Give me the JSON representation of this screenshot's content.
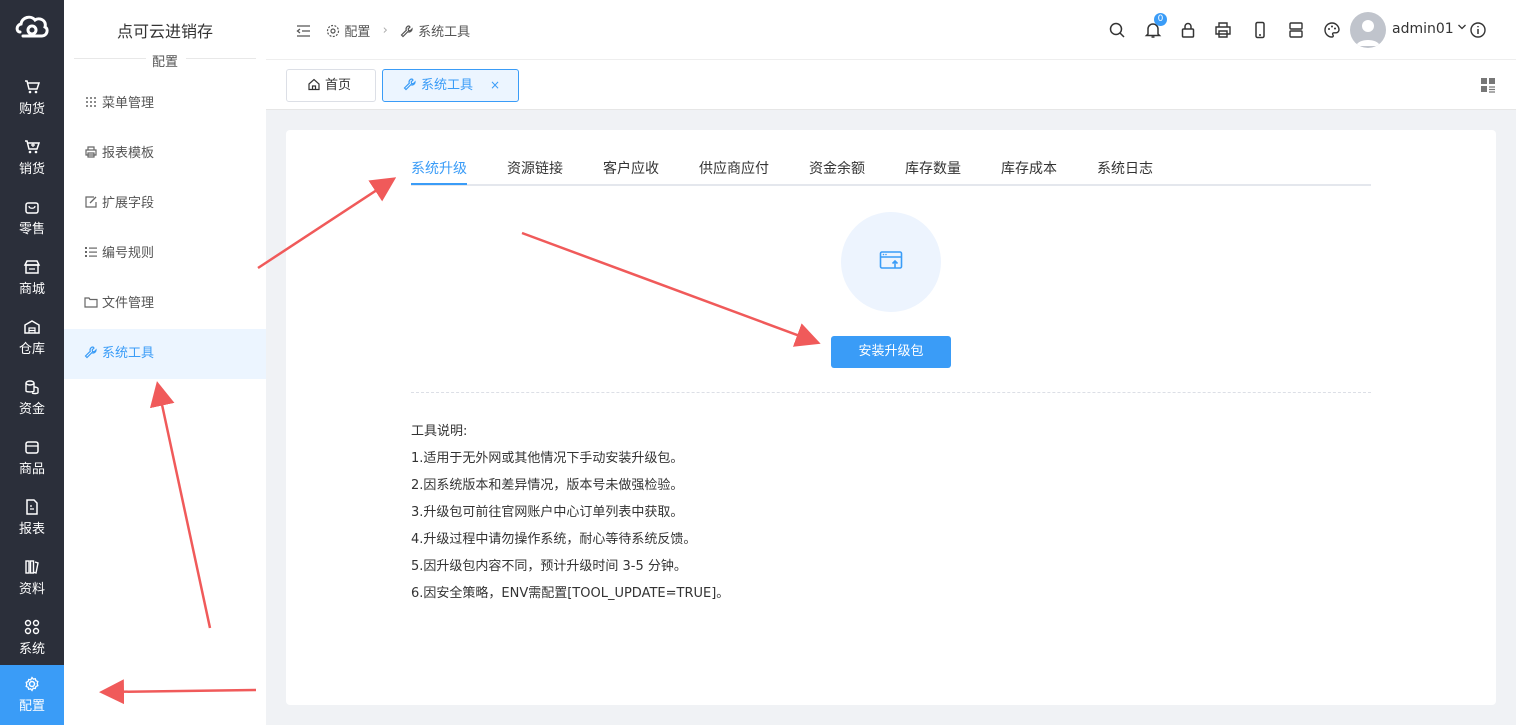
{
  "app": {
    "title": "点可云进销存"
  },
  "leftnav": {
    "items": [
      {
        "label": "购货",
        "icon": "cart-icon"
      },
      {
        "label": "销货",
        "icon": "cart-plus-icon"
      },
      {
        "label": "零售",
        "icon": "bag-icon"
      },
      {
        "label": "商城",
        "icon": "store-icon"
      },
      {
        "label": "仓库",
        "icon": "warehouse-icon"
      },
      {
        "label": "资金",
        "icon": "coins-icon"
      },
      {
        "label": "商品",
        "icon": "box-icon"
      },
      {
        "label": "报表",
        "icon": "report-icon"
      },
      {
        "label": "资料",
        "icon": "books-icon"
      },
      {
        "label": "系统",
        "icon": "grid-icon"
      },
      {
        "label": "配置",
        "icon": "gear-icon",
        "active": true
      }
    ]
  },
  "subnav": {
    "heading": "配置",
    "items": [
      {
        "label": "菜单管理",
        "icon": "dots-grid-icon"
      },
      {
        "label": "报表模板",
        "icon": "printer-icon"
      },
      {
        "label": "扩展字段",
        "icon": "edit-icon"
      },
      {
        "label": "编号规则",
        "icon": "list-numbered-icon"
      },
      {
        "label": "文件管理",
        "icon": "folder-icon"
      },
      {
        "label": "系统工具",
        "icon": "wrench-icon",
        "active": true
      }
    ]
  },
  "header": {
    "breadcrumb": [
      "配置",
      "系统工具"
    ],
    "notification_count": "0",
    "username": "admin01"
  },
  "tags": {
    "home": "首页",
    "current": "系统工具",
    "close": "×"
  },
  "main": {
    "tabs": [
      "系统升级",
      "资源链接",
      "客户应收",
      "供应商应付",
      "资金余额",
      "库存数量",
      "库存成本",
      "系统日志"
    ],
    "active_tab": "系统升级",
    "install_button": "安装升级包",
    "notes_title": "工具说明:",
    "notes": [
      "1.适用于无外网或其他情况下手动安装升级包。",
      "2.因系统版本和差异情况，版本号未做强检验。",
      "3.升级包可前往官网账户中心订单列表中获取。",
      "4.升级过程中请勿操作系统，耐心等待系统反馈。",
      "5.因升级包内容不同，预计升级时间 3-5 分钟。",
      "6.因安全策略，ENV需配置[TOOL_UPDATE=TRUE]。"
    ]
  },
  "colors": {
    "nav_bg": "#2b2f3a",
    "accent": "#3a9cf7",
    "arrow": "#f05a5a"
  }
}
